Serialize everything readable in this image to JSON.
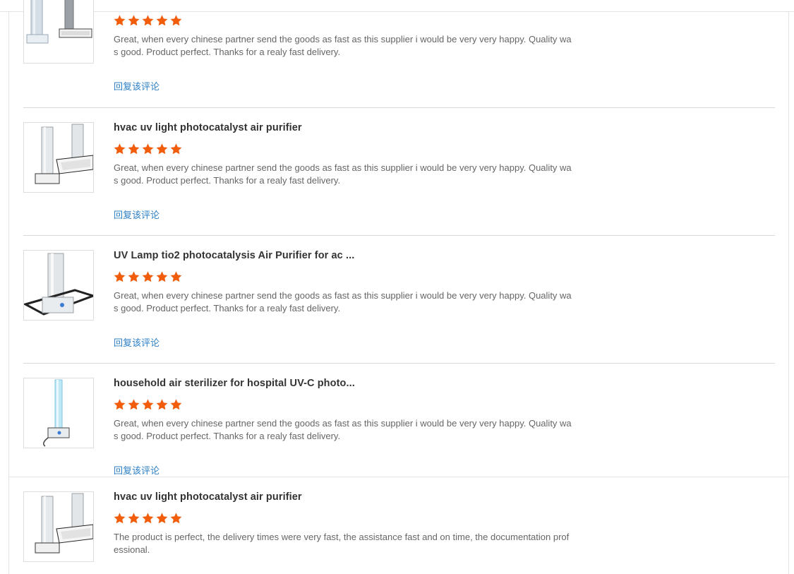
{
  "reviews": [
    {
      "title": "",
      "rating": 5,
      "text": "Great, when every chinese partner send the goods as fast as this supplier i would be very very happy. Quality was good. Product perfect. Thanks for a realy fast delivery.",
      "reply_label": "回复该评论",
      "thumb_icon": "uv-column-purifier-icon"
    },
    {
      "title": "hvac uv light photocatalyst air purifier",
      "rating": 5,
      "text": "Great, when every chinese partner send the goods as fast as this supplier i would be very very happy. Quality was good. Product perfect. Thanks for a realy fast delivery.",
      "reply_label": "回复该评论",
      "thumb_icon": "uv-column-purifier-icon"
    },
    {
      "title": "UV Lamp tio2 photocatalysis Air Purifier for ac ...",
      "rating": 5,
      "text": "Great, when every chinese partner send the goods as fast as this supplier i would be very very happy. Quality was good. Product perfect. Thanks for a realy fast delivery.",
      "reply_label": "回复该评论",
      "thumb_icon": "uv-lamp-purifier-icon"
    },
    {
      "title": "household air sterilizer for hospital UV-C photo...",
      "rating": 5,
      "text": "Great, when every chinese partner send the goods as fast as this supplier i would be very very happy. Quality was good. Product perfect. Thanks for a realy fast delivery.",
      "reply_label": "回复该评论",
      "thumb_icon": "uv-c-sterilizer-icon"
    },
    {
      "title": "hvac uv light photocatalyst air purifier",
      "rating": 5,
      "text": "The product is perfect, the delivery times were very fast, the assistance fast and on time, the documentation professional.",
      "reply_label": "",
      "thumb_icon": "uv-column-purifier-icon"
    }
  ],
  "colors": {
    "star": "#f25d0c",
    "link": "#2e80c5",
    "title": "#333333",
    "body": "#666666"
  }
}
